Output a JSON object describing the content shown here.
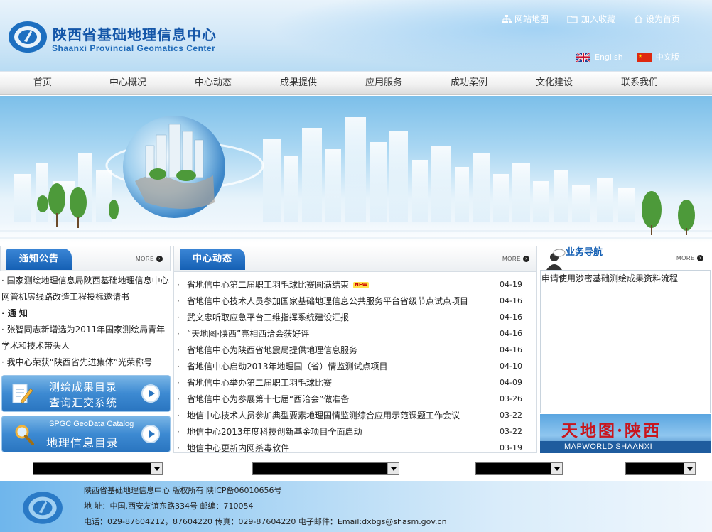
{
  "header": {
    "title_cn": "陕西省基础地理信息中心",
    "title_en": "Shaanxi Provincial Geomatics Center",
    "links": [
      {
        "label": "网站地图",
        "icon": "sitemap-icon"
      },
      {
        "label": "加入收藏",
        "icon": "folder-icon"
      },
      {
        "label": "设为首页",
        "icon": "home-icon"
      }
    ],
    "languages": [
      {
        "label": "English",
        "icon": "uk-flag-icon"
      },
      {
        "label": "中文版",
        "icon": "china-flag-icon"
      }
    ]
  },
  "nav": {
    "items": [
      "首页",
      "中心概况",
      "中心动态",
      "成果提供",
      "应用服务",
      "成功案例",
      "文化建设",
      "联系我们"
    ]
  },
  "notice": {
    "title": "通知公告",
    "more": "MORE",
    "items": [
      {
        "text": "· 国家测绘地理信息局陕西基础地理信息中心网管机房线路改造工程投标邀请书",
        "bold": false
      },
      {
        "text": "· 通 知",
        "bold": true
      },
      {
        "text": "· 张智同志新增选为2011年国家测绘局青年学术和技术带头人",
        "bold": false
      },
      {
        "text": "· 我中心荣获“陕西省先进集体”光荣称号",
        "bold": false
      }
    ]
  },
  "promos": [
    {
      "line1": "测绘成果目录",
      "line2": "查询汇交系统",
      "icon": "document-pen-icon"
    },
    {
      "line1": "SPGC GeoData Catalog",
      "line2": "地理信息目录",
      "icon": "magnifier-icon"
    }
  ],
  "news": {
    "title": "中心动态",
    "more": "MORE",
    "new_label": "NEW",
    "items": [
      {
        "title": "省地信中心第二届职工羽毛球比赛圆满结束",
        "date": "04-19",
        "is_new": true
      },
      {
        "title": "省地信中心技术人员参加国家基础地理信息公共服务平台省级节点试点项目",
        "date": "04-16",
        "is_new": false
      },
      {
        "title": "武文忠听取应急平台三维指挥系统建设汇报",
        "date": "04-16",
        "is_new": false
      },
      {
        "title": "“天地图·陕西”亮相西洽会获好评",
        "date": "04-16",
        "is_new": false
      },
      {
        "title": "省地信中心为陕西省地震局提供地理信息服务",
        "date": "04-16",
        "is_new": false
      },
      {
        "title": "省地信中心启动2013年地理国（省）情监测试点项目",
        "date": "04-10",
        "is_new": false
      },
      {
        "title": "省地信中心举办第二届职工羽毛球比赛",
        "date": "04-09",
        "is_new": false
      },
      {
        "title": "省地信中心为参展第十七届“西洽会”做准备",
        "date": "03-26",
        "is_new": false
      },
      {
        "title": "地信中心技术人员参加典型要素地理国情监测综合应用示范课题工作会议",
        "date": "03-22",
        "is_new": false
      },
      {
        "title": "地信中心2013年度科技创新基金项目全面启动",
        "date": "03-22",
        "is_new": false
      },
      {
        "title": "地信中心更新内网杀毒软件",
        "date": "03-19",
        "is_new": false
      }
    ]
  },
  "business": {
    "title": "业务导航",
    "more": "MORE",
    "items": [
      "申请使用涉密基础测绘成果资料流程"
    ]
  },
  "mapworld": {
    "title_cn": "天地图·陕西",
    "title_en": "MAPWORLD SHAANXI"
  },
  "footer": {
    "line1": "陕西省基础地理信息中心 版权所有 陕ICP备06010656号",
    "line2": "地 址：中国.西安友谊东路334号 邮编：710054",
    "line3": "电话：029-87604212，87604220 传真：029-87604220 电子邮件：Email:dxbgs@shasm.gov.cn"
  },
  "colors": {
    "brand_blue": "#1456a8",
    "tab_blue": "#1560b4",
    "footer_blue": "#6fb6ec"
  }
}
